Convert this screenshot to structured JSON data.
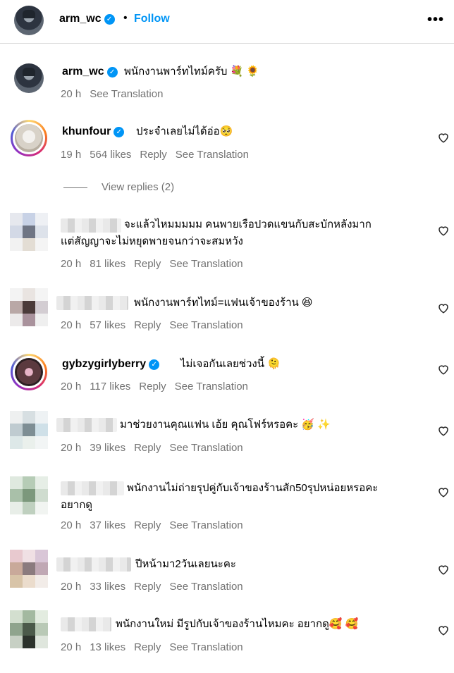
{
  "header": {
    "username": "arm_wc",
    "follow_label": "Follow",
    "separator": "•",
    "more": "•••"
  },
  "caption": {
    "username": "arm_wc",
    "text": "พนักงานพาร์ทไทม์ครับ 💐 🌻",
    "time": "20 h",
    "translate": "See Translation"
  },
  "comments": [
    {
      "username": "khunfour",
      "verified": true,
      "text": "ประจำเลยไม่ได้อ่อ🥺",
      "time": "19 h",
      "likes": "564 likes",
      "reply": "Reply",
      "translate": "See Translation",
      "view_replies": "View replies (2)"
    },
    {
      "username": "",
      "text": "จะแล้วไหมมมมม คนพายเรือปวดแขนกับสะบักหลังมาก",
      "text2": "แต่สัญญาจะไม่หยุดพายจนกว่าจะสมหวัง",
      "time": "20 h",
      "likes": "81 likes",
      "reply": "Reply",
      "translate": "See Translation"
    },
    {
      "username": "",
      "text": "พนักงานพาร์ทไทม์=แฟนเจ้าของร้าน 😆",
      "time": "20 h",
      "likes": "57 likes",
      "reply": "Reply",
      "translate": "See Translation"
    },
    {
      "username": "gybzygirlyberry",
      "verified": true,
      "text": "ไม่เจอกันเลยช่วงนี้ 🫠",
      "time": "20 h",
      "likes": "117 likes",
      "reply": "Reply",
      "translate": "See Translation"
    },
    {
      "username": "",
      "text": "มาช่วยงานคุณแฟน เอ้ย คุณโฟร์หรอคะ 🥳 ✨",
      "time": "20 h",
      "likes": "39 likes",
      "reply": "Reply",
      "translate": "See Translation"
    },
    {
      "username": "",
      "text": "พนักงานไม่ถ่ายรุปคู่กับเจ้าของร้านสัก50รุปหน่อยหรอคะ",
      "text2": "อยากดู",
      "time": "20 h",
      "likes": "37 likes",
      "reply": "Reply",
      "translate": "See Translation"
    },
    {
      "username": "",
      "text": "ปีหน้ามา2วันเลยนะคะ",
      "time": "20 h",
      "likes": "33 likes",
      "reply": "Reply",
      "translate": "See Translation"
    },
    {
      "username": "",
      "text": "พนักงานใหม่ มีรูปกับเจ้าของร้านไหมคะ อยากดู🥰 🥰",
      "time": "20 h",
      "likes": "13 likes",
      "reply": "Reply",
      "translate": "See Translation"
    }
  ],
  "colors": {
    "link": "#0095f6",
    "muted": "#737373",
    "divider": "#dbdbdb"
  }
}
